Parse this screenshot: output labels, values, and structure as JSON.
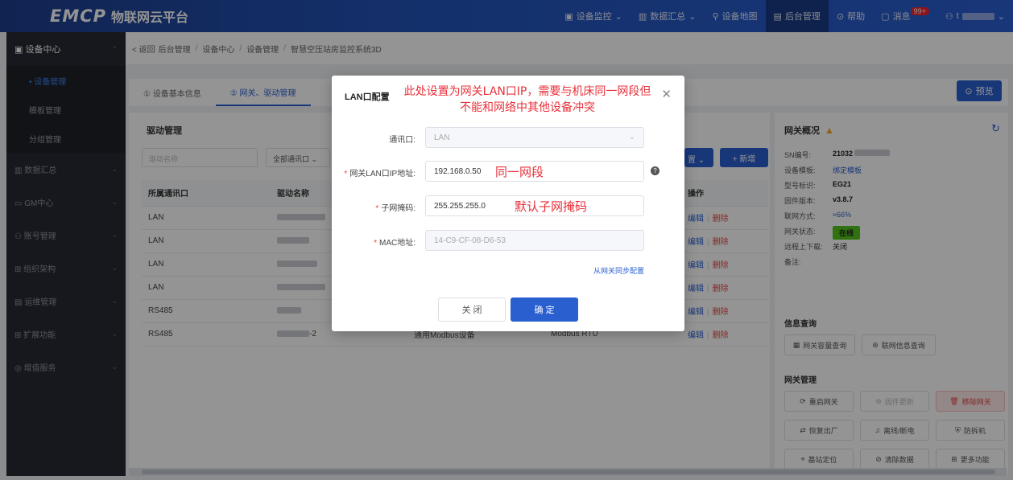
{
  "header": {
    "logo_mark": "EMCP",
    "logo_text": "物联网云平台",
    "nav": [
      {
        "label": "设备监控",
        "icon": "monitor-icon",
        "caret": "⌄"
      },
      {
        "label": "数据汇总",
        "icon": "bar-chart-icon",
        "caret": "⌄"
      },
      {
        "label": "设备地图",
        "icon": "map-pin-icon",
        "caret": ""
      },
      {
        "label": "后台管理",
        "icon": "admin-icon",
        "caret": ""
      },
      {
        "label": "帮助",
        "icon": "help-icon",
        "caret": ""
      },
      {
        "label": "消息",
        "icon": "message-icon",
        "caret": "",
        "badge": "99+"
      },
      {
        "label": "t",
        "icon": "user-icon",
        "caret": "⌄"
      }
    ]
  },
  "sidebar": {
    "groups": [
      {
        "label": "设备中心",
        "icon": "device-icon",
        "open": true,
        "subs": [
          {
            "label": "• 设备管理",
            "active": true
          },
          {
            "label": "模板管理"
          },
          {
            "label": "分组管理"
          }
        ]
      },
      {
        "label": "数据汇总",
        "icon": "bar-chart-icon"
      },
      {
        "label": "GM中心",
        "icon": "gm-icon"
      },
      {
        "label": "账号管理",
        "icon": "account-icon"
      },
      {
        "label": "组织架构",
        "icon": "org-icon"
      },
      {
        "label": "运维管理",
        "icon": "ops-icon"
      },
      {
        "label": "扩展功能",
        "icon": "grid-icon"
      },
      {
        "label": "增值服务",
        "icon": "service-icon"
      }
    ]
  },
  "breadcrumb": {
    "back": "< 返回",
    "items": [
      "后台管理",
      "设备中心",
      "设备管理",
      "智慧空压站房监控系统3D"
    ],
    "sep": "/"
  },
  "tabs": [
    {
      "label": "① 设备基本信息",
      "active": false
    },
    {
      "label": "② 网关、驱动管理",
      "active": true
    }
  ],
  "preview_button": "预览",
  "driver_panel": {
    "title": "驱动管理",
    "filter_placeholder": "驱动名称",
    "filter_port": "全部通讯口",
    "more_label": "置",
    "add_label": "+ 新增",
    "columns": [
      "所属通讯口",
      "驱动名称",
      "",
      "",
      "操作"
    ],
    "rows": [
      {
        "port": "LAN",
        "name": "",
        "type": "",
        "protocol": ""
      },
      {
        "port": "LAN",
        "name": "",
        "type": "",
        "protocol": ""
      },
      {
        "port": "LAN",
        "name": "",
        "type": "",
        "protocol": ""
      },
      {
        "port": "LAN",
        "name": "",
        "type": "",
        "protocol": ""
      },
      {
        "port": "RS485",
        "name": "",
        "type": "",
        "protocol": ""
      },
      {
        "port": "RS485",
        "name": "-2",
        "type": "通用Modbus设备",
        "protocol": "Modbus RTU"
      }
    ],
    "edit_label": "编辑",
    "delete_label": "删除"
  },
  "gateway_panel": {
    "title": "网关概况",
    "info": [
      {
        "k": "SN编号:",
        "v": "21032",
        "style": ""
      },
      {
        "k": "设备模板:",
        "v": "绑定模板",
        "style": "link"
      },
      {
        "k": "型号标识:",
        "v": "EG21",
        "style": ""
      },
      {
        "k": "固件版本:",
        "v": "v3.8.7",
        "style": ""
      },
      {
        "k": "联网方式:",
        "v": "66%",
        "style": "blue"
      },
      {
        "k": "网关状态:",
        "v": "在线",
        "style": "online"
      },
      {
        "k": "远程上下载:",
        "v": "关闭",
        "style": "plain"
      },
      {
        "k": "备注:",
        "v": "",
        "style": ""
      }
    ],
    "query_title": "信息查询",
    "query_buttons": [
      "网关容量查询",
      "联网信息查询"
    ],
    "manage_title": "网关管理",
    "manage_buttons": [
      "重启网关",
      "固件更新",
      "移除网关",
      "恢复出厂",
      "离线/断电",
      "防拆机",
      "基站定位",
      "清除数据",
      "更多功能"
    ]
  },
  "modal": {
    "title": "LAN口配置",
    "annotation_top": "此处设置为网关LAN口IP，需要与机床同一网段但不能和网络中其他设备冲突",
    "fields": [
      {
        "label": "通讯口:",
        "value": "LAN",
        "required": false,
        "disabled": true,
        "annot": ""
      },
      {
        "label": "网关LAN口IP地址:",
        "value": "192.168.0.50",
        "required": true,
        "disabled": false,
        "annot": "同一网段"
      },
      {
        "label": "子网掩码:",
        "value": "255.255.255.0",
        "required": true,
        "disabled": false,
        "annot": "默认子网掩码"
      },
      {
        "label": "MAC地址:",
        "value": "14-C9-CF-08-D6-53",
        "required": true,
        "disabled": true,
        "annot": ""
      }
    ],
    "sync_link": "从网关同步配置",
    "cancel_label": "关 闭",
    "ok_label": "确 定"
  }
}
